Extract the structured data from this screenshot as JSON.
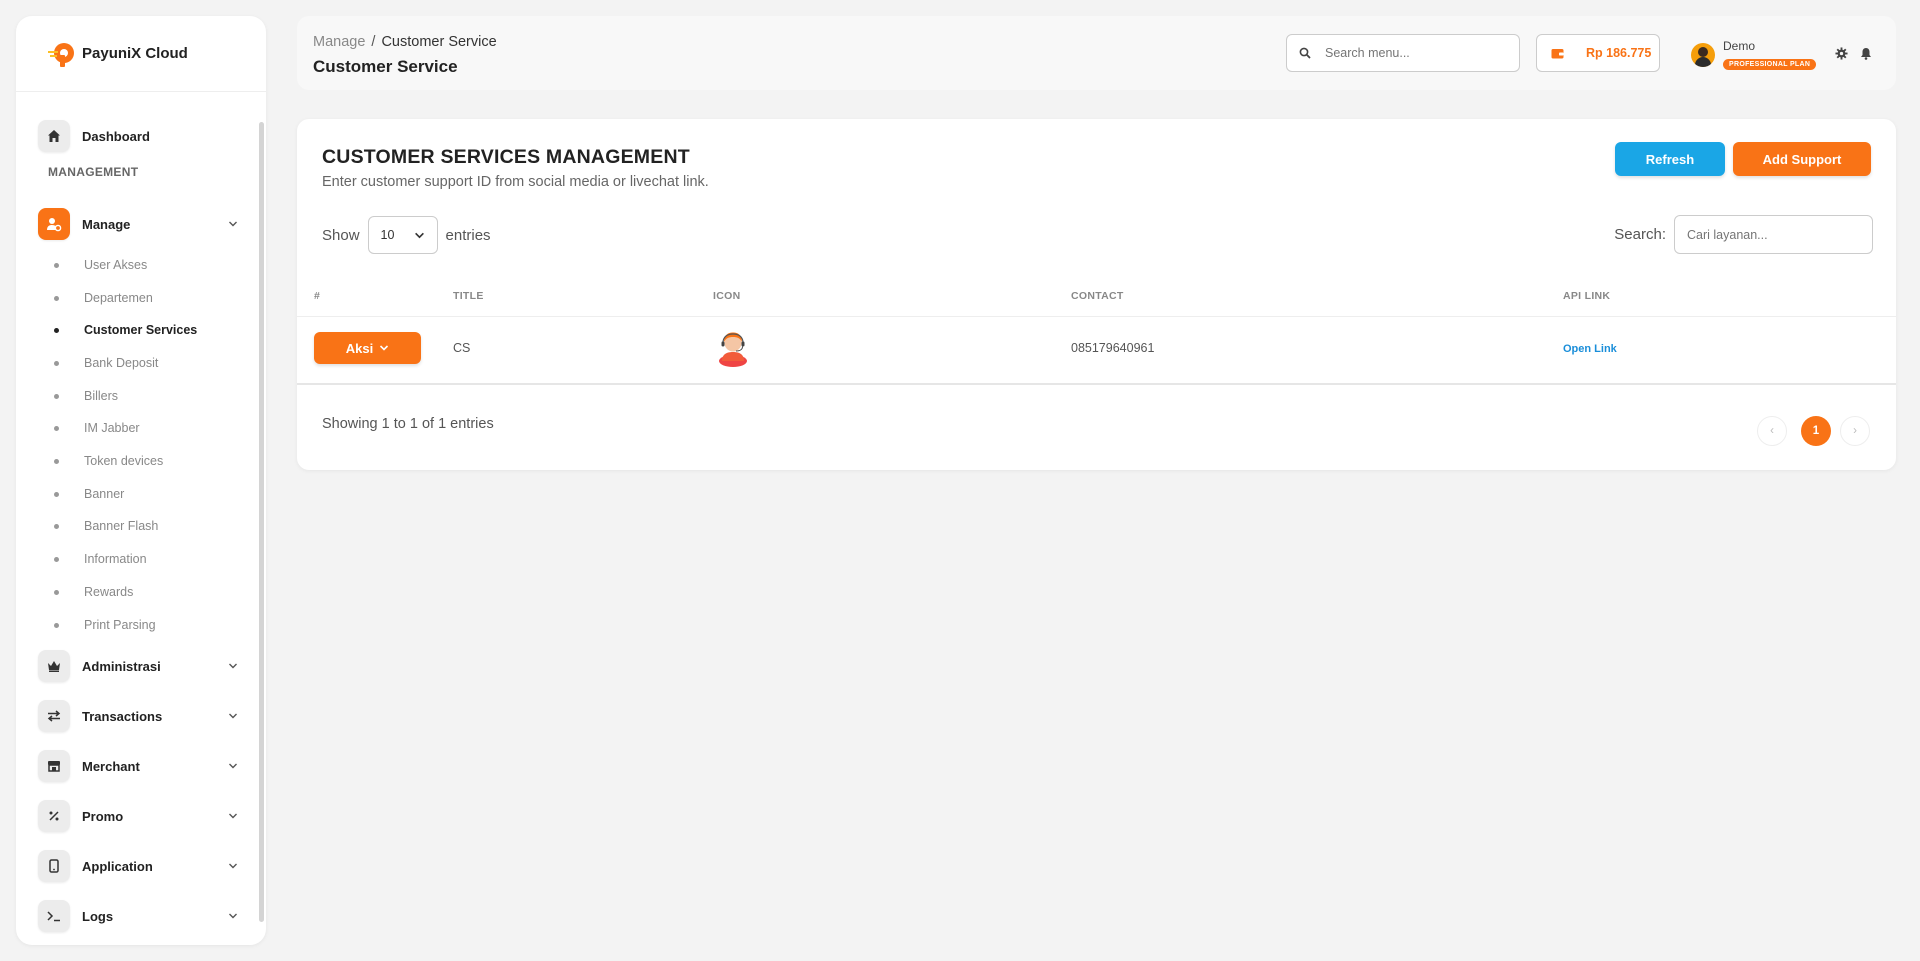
{
  "brand": {
    "name": "PayuniX Cloud"
  },
  "sidebar": {
    "dashboard": "Dashboard",
    "section_management": "MANAGEMENT",
    "manage": "Manage",
    "manage_items": [
      "User Akses",
      "Departemen",
      "Customer Services",
      "Bank Deposit",
      "Billers",
      "IM Jabber",
      "Token devices",
      "Banner",
      "Banner Flash",
      "Information",
      "Rewards",
      "Print Parsing"
    ],
    "active_item": "Customer Services",
    "groups": [
      "Administrasi",
      "Transactions",
      "Merchant",
      "Promo",
      "Application",
      "Logs"
    ]
  },
  "header": {
    "breadcrumb_parent": "Manage",
    "breadcrumb_sep": "/",
    "breadcrumb_current": "Customer Service",
    "page_title": "Customer Service",
    "search_placeholder": "Search menu...",
    "balance": "Rp 186.775",
    "user_name": "Demo",
    "plan": "PROFESSIONAL PLAN"
  },
  "card": {
    "title": "CUSTOMER SERVICES MANAGEMENT",
    "subtitle": "Enter customer support ID from social media or livechat link.",
    "refresh_label": "Refresh",
    "add_label": "Add Support",
    "show_label": "Show",
    "entries_value": "10",
    "entries_label": "entries",
    "search_label": "Search:",
    "search_placeholder": "Cari layanan...",
    "columns": [
      "#",
      "TITLE",
      "ICON",
      "CONTACT",
      "API LINK"
    ],
    "rows": [
      {
        "action": "Aksi",
        "title": "CS",
        "contact": "085179640961",
        "link": "Open Link"
      }
    ],
    "showing": "Showing 1 to 1 of 1 entries",
    "page_prev": "‹",
    "page_current": "1",
    "page_next": "›"
  },
  "colors": {
    "accent": "#f97316",
    "info": "#1aa6e6",
    "link": "#1a8ed9"
  }
}
